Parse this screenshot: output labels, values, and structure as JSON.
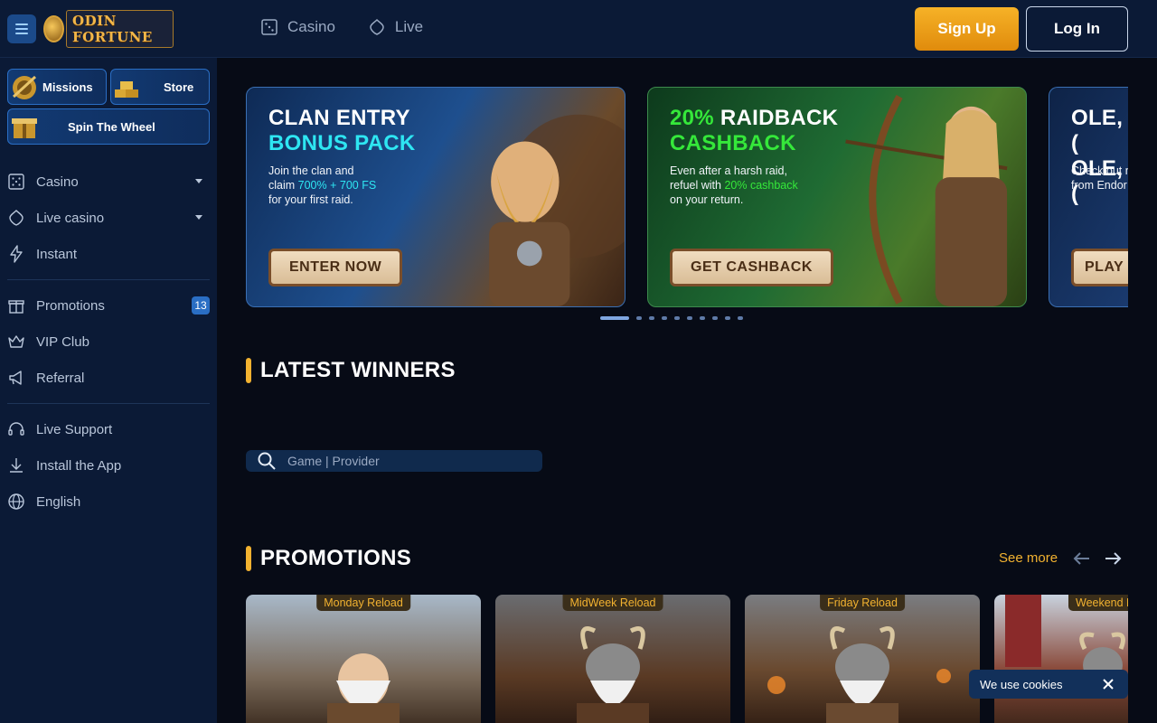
{
  "header": {
    "logo_text": "ODIN FORTUNE",
    "nav": [
      {
        "label": "Casino",
        "icon": "dice-icon"
      },
      {
        "label": "Live",
        "icon": "diamond-icon"
      }
    ],
    "signup_label": "Sign Up",
    "login_label": "Log In"
  },
  "sidebar": {
    "chips": {
      "missions": "Missions",
      "store": "Store",
      "wheel": "Spin The Wheel"
    },
    "items": [
      {
        "label": "Casino"
      },
      {
        "label": "Live casino"
      },
      {
        "label": "Instant"
      },
      {
        "label": "Promotions",
        "badge": "13"
      },
      {
        "label": "VIP Club"
      },
      {
        "label": "Referral"
      },
      {
        "label": "Live Support"
      },
      {
        "label": "Install the App"
      },
      {
        "label": "English"
      }
    ]
  },
  "banners": [
    {
      "title_1": "CLAN ENTRY",
      "title_2": "BONUS PACK",
      "text_1": "Join the clan and",
      "text_2": "claim ",
      "highlight": "700% + 700 FS",
      "text_3": "for your first raid.",
      "button": "ENTER NOW"
    },
    {
      "title_1": "20%",
      "title_1b": " RAIDBACK",
      "title_2": "CASHBACK",
      "text_1": "Even after a harsh raid,",
      "text_2": "refuel with ",
      "highlight": "20% cashback",
      "text_3": "on your return.",
      "button": "GET CASHBACK"
    },
    {
      "title_1": "OLE, (",
      "title_2": "OLE, (",
      "text_1": "Check out n",
      "text_2": "from Endor",
      "button": "PLAY"
    }
  ],
  "sections": {
    "winners_title": "LATEST WINNERS",
    "promotions_title": "PROMOTIONS",
    "see_more": "See more"
  },
  "search": {
    "placeholder": "Game | Provider"
  },
  "promos": [
    {
      "tag": "Monday Reload"
    },
    {
      "tag": "MidWeek Reload"
    },
    {
      "tag": "Friday Reload"
    },
    {
      "tag": "Weekend Re"
    }
  ],
  "cookie": {
    "text": "We use cookies"
  },
  "colors": {
    "accent": "#f2b230",
    "header_bg": "#0b1a36",
    "page_bg": "#070b16",
    "cyan": "#2ee6f2",
    "green": "#35e83a"
  }
}
